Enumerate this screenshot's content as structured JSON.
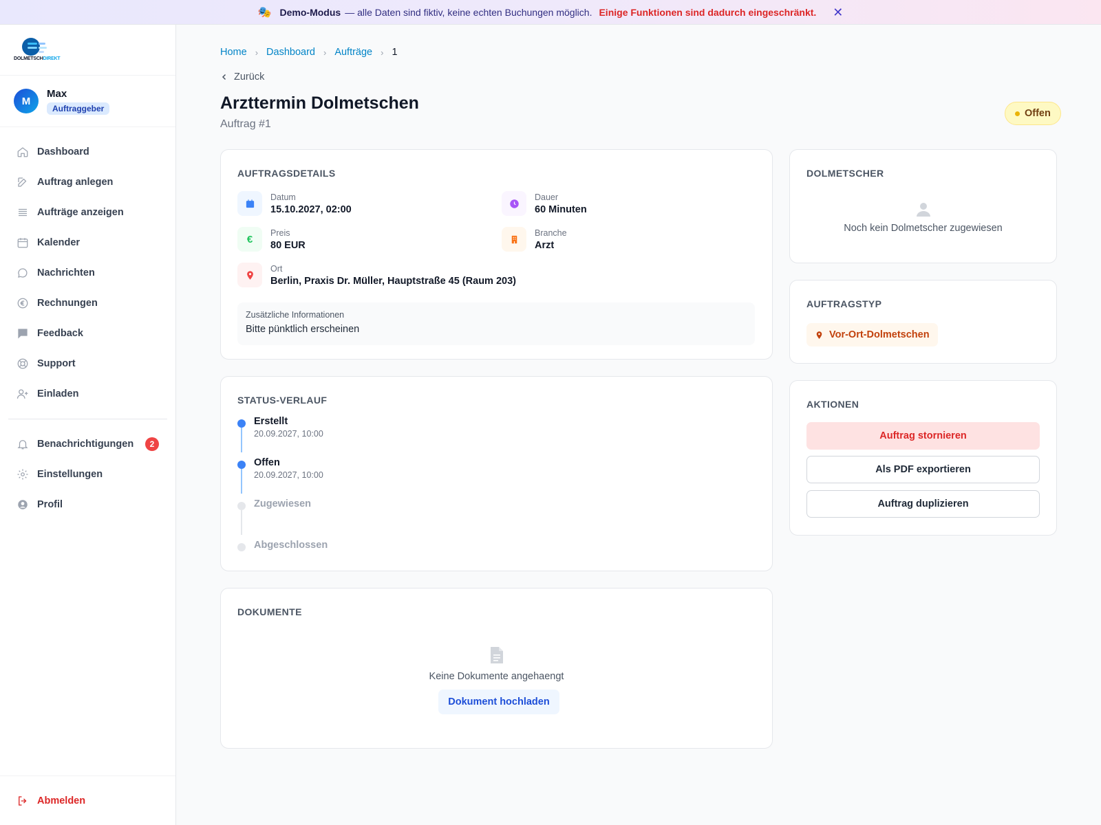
{
  "banner": {
    "mode_label": "Demo-Modus",
    "message": "— alle Daten sind fiktiv, keine echten Buchungen möglich.",
    "warning": "Einige Funktionen sind dadurch eingeschränkt.",
    "close_glyph": "✕"
  },
  "brand": {
    "wordmark_a": "DOLMETSCH",
    "wordmark_b": "DIREKT"
  },
  "user": {
    "initial": "M",
    "name": "Max",
    "role": "Auftraggeber"
  },
  "nav": {
    "items": [
      {
        "label": "Dashboard",
        "icon": "home-icon"
      },
      {
        "label": "Auftrag anlegen",
        "icon": "edit-icon"
      },
      {
        "label": "Aufträge anzeigen",
        "icon": "list-icon"
      },
      {
        "label": "Kalender",
        "icon": "calendar-icon"
      },
      {
        "label": "Nachrichten",
        "icon": "chat-icon"
      },
      {
        "label": "Rechnungen",
        "icon": "euro-icon"
      },
      {
        "label": "Feedback",
        "icon": "feedback-icon"
      },
      {
        "label": "Support",
        "icon": "lifebuoy-icon"
      },
      {
        "label": "Einladen",
        "icon": "user-plus-icon"
      }
    ],
    "secondary": [
      {
        "label": "Benachrichtigungen",
        "icon": "bell-icon",
        "badge": "2"
      },
      {
        "label": "Einstellungen",
        "icon": "gear-icon"
      },
      {
        "label": "Profil",
        "icon": "user-circle-icon"
      }
    ],
    "logout": "Abmelden"
  },
  "breadcrumb": {
    "home": "Home",
    "dashboard": "Dashboard",
    "orders": "Aufträge",
    "current": "1"
  },
  "page": {
    "back": "Zurück",
    "title": "Arzttermin Dolmetschen",
    "subtitle": "Auftrag #1",
    "status": "Offen"
  },
  "details": {
    "title": "AUFTRAGSDETAILS",
    "date_label": "Datum",
    "date_value": "15.10.2027, 02:00",
    "duration_label": "Dauer",
    "duration_value": "60 Minuten",
    "price_label": "Preis",
    "price_value": "80 EUR",
    "branch_label": "Branche",
    "branch_value": "Arzt",
    "location_label": "Ort",
    "location_value": "Berlin, Praxis Dr. Müller, Hauptstraße 45 (Raum 203)",
    "extra_label": "Zusätzliche Informationen",
    "extra_value": "Bitte pünktlich erscheinen"
  },
  "timeline": {
    "title": "STATUS-VERLAUF",
    "items": [
      {
        "label": "Erstellt",
        "time": "20.09.2027, 10:00"
      },
      {
        "label": "Offen",
        "time": "20.09.2027, 10:00"
      },
      {
        "label": "Zugewiesen",
        "time": ""
      },
      {
        "label": "Abgeschlossen",
        "time": ""
      }
    ]
  },
  "documents": {
    "title": "DOKUMENTE",
    "empty": "Keine Dokumente angehaengt",
    "upload": "Dokument hochladen"
  },
  "interpreter": {
    "title": "DOLMETSCHER",
    "empty": "Noch kein Dolmetscher zugewiesen"
  },
  "order_type": {
    "title": "AUFTRAGSTYP",
    "value": "Vor-Ort-Dolmetschen"
  },
  "actions": {
    "title": "AKTIONEN",
    "cancel": "Auftrag stornieren",
    "pdf": "Als PDF exportieren",
    "duplicate": "Auftrag duplizieren"
  },
  "colors": {
    "accent": "#0284c7",
    "danger": "#dc2626",
    "status_open": "#fef9c3",
    "timeline_active": "#3b82f6"
  }
}
